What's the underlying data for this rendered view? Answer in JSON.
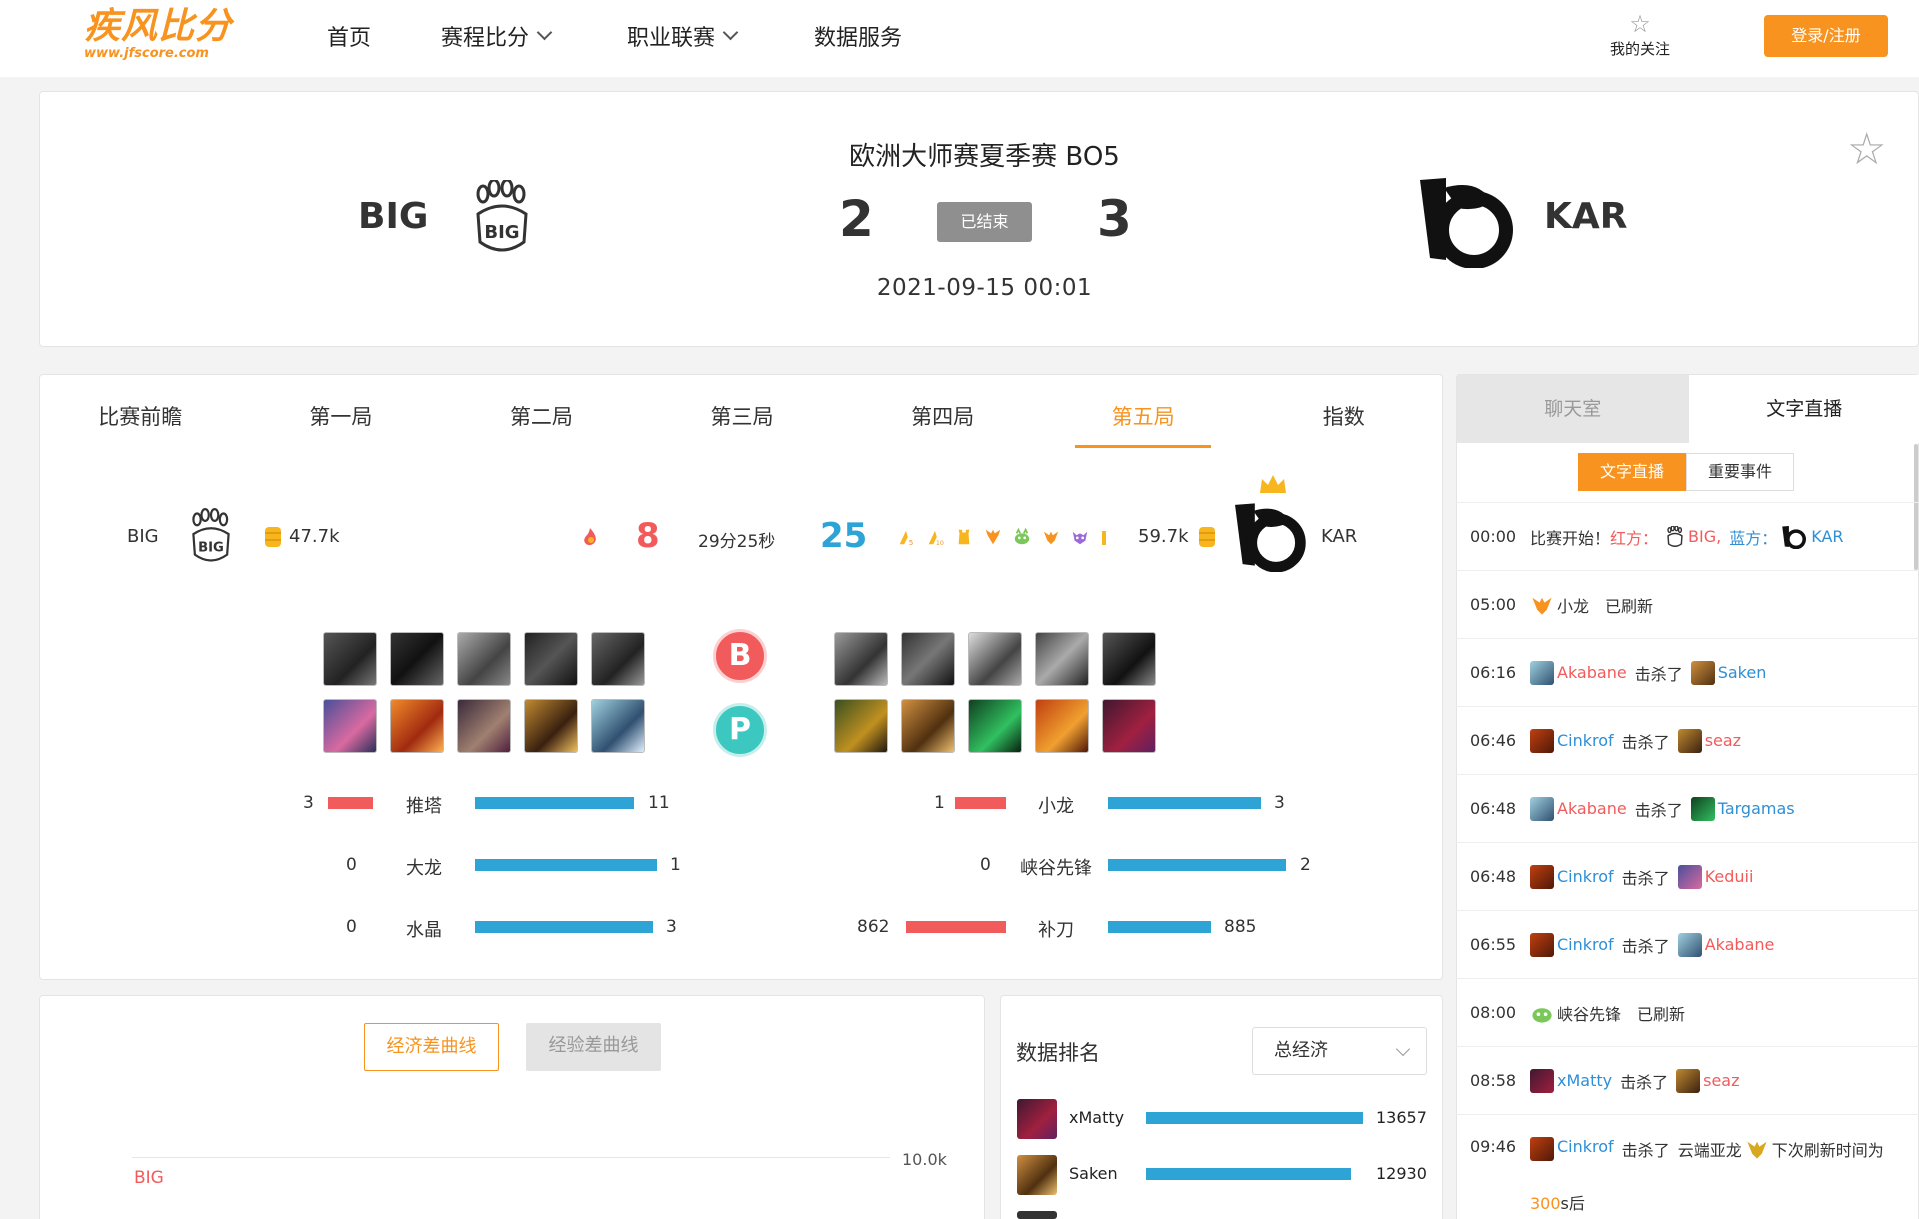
{
  "header": {
    "logo_text": "疾风比分",
    "logo_url": "www.jfscore.com",
    "nav": [
      "首页",
      "赛程比分",
      "职业联赛",
      "数据服务"
    ],
    "favorites_label": "我的关注",
    "login_label": "登录/注册"
  },
  "match": {
    "title": "欧洲大师赛夏季赛 BO5",
    "team_left": "BIG",
    "team_right": "KAR",
    "score_left": "2",
    "score_right": "3",
    "status": "已结束",
    "date": "2021-09-15 00:01"
  },
  "game": {
    "tabs": [
      "比赛前瞻",
      "第一局",
      "第二局",
      "第三局",
      "第四局",
      "第五局",
      "指数"
    ],
    "active_tab": "第五局",
    "left_team": "BIG",
    "right_team": "KAR",
    "left_gold": "47.7k",
    "right_gold": "59.7k",
    "left_kills": "8",
    "right_kills": "25",
    "duration": "29分25秒",
    "ban_label": "B",
    "pick_label": "P",
    "stats": [
      {
        "label": "推塔",
        "left": "3",
        "right": "11"
      },
      {
        "label": "大龙",
        "left": "0",
        "right": "1"
      },
      {
        "label": "水晶",
        "left": "0",
        "right": "3"
      },
      {
        "label": "小龙",
        "left": "1",
        "right": "3"
      },
      {
        "label": "峡谷先锋",
        "left": "0",
        "right": "2"
      },
      {
        "label": "补刀",
        "left": "862",
        "right": "885"
      }
    ]
  },
  "curve": {
    "btn_gold": "经济差曲线",
    "btn_xp": "经验差曲线",
    "tick": "10.0k",
    "team_label": "BIG"
  },
  "ranking": {
    "title": "数据排名",
    "selected": "总经济",
    "rows": [
      {
        "name": "xMatty",
        "value": "13657"
      },
      {
        "name": "Saken",
        "value": "12930"
      }
    ]
  },
  "sidebar": {
    "tab_chat": "聊天室",
    "tab_live": "文字直播",
    "seg_live": "文字直播",
    "seg_events": "重要事件",
    "feed": [
      {
        "time": "00:00",
        "a": "比赛开始！",
        "b": "红方：",
        "c": "BIG,",
        "d": "蓝方：",
        "e": "KAR"
      },
      {
        "time": "05:00",
        "a": "小龙",
        "b": "已刷新"
      },
      {
        "time": "06:16",
        "killer": "Akabane",
        "verb": "击杀了",
        "victim": "Saken"
      },
      {
        "time": "06:46",
        "killer": "Cinkrof",
        "verb": "击杀了",
        "victim": "seaz"
      },
      {
        "time": "06:48",
        "killer": "Akabane",
        "verb": "击杀了",
        "victim": "Targamas"
      },
      {
        "time": "06:48",
        "killer": "Cinkrof",
        "verb": "击杀了",
        "victim": "Keduii"
      },
      {
        "time": "06:55",
        "killer": "Cinkrof",
        "verb": "击杀了",
        "victim": "Akabane"
      },
      {
        "time": "08:00",
        "a": "峡谷先锋",
        "b": "已刷新"
      },
      {
        "time": "08:58",
        "killer": "xMatty",
        "verb": "击杀了",
        "victim": "seaz"
      },
      {
        "time": "09:46",
        "killer": "Cinkrof",
        "verb": "击杀了",
        "victim": "云端亚龙",
        "suffix": "下次刷新时间为",
        "cont": "300",
        "cont2": "s后"
      }
    ]
  }
}
